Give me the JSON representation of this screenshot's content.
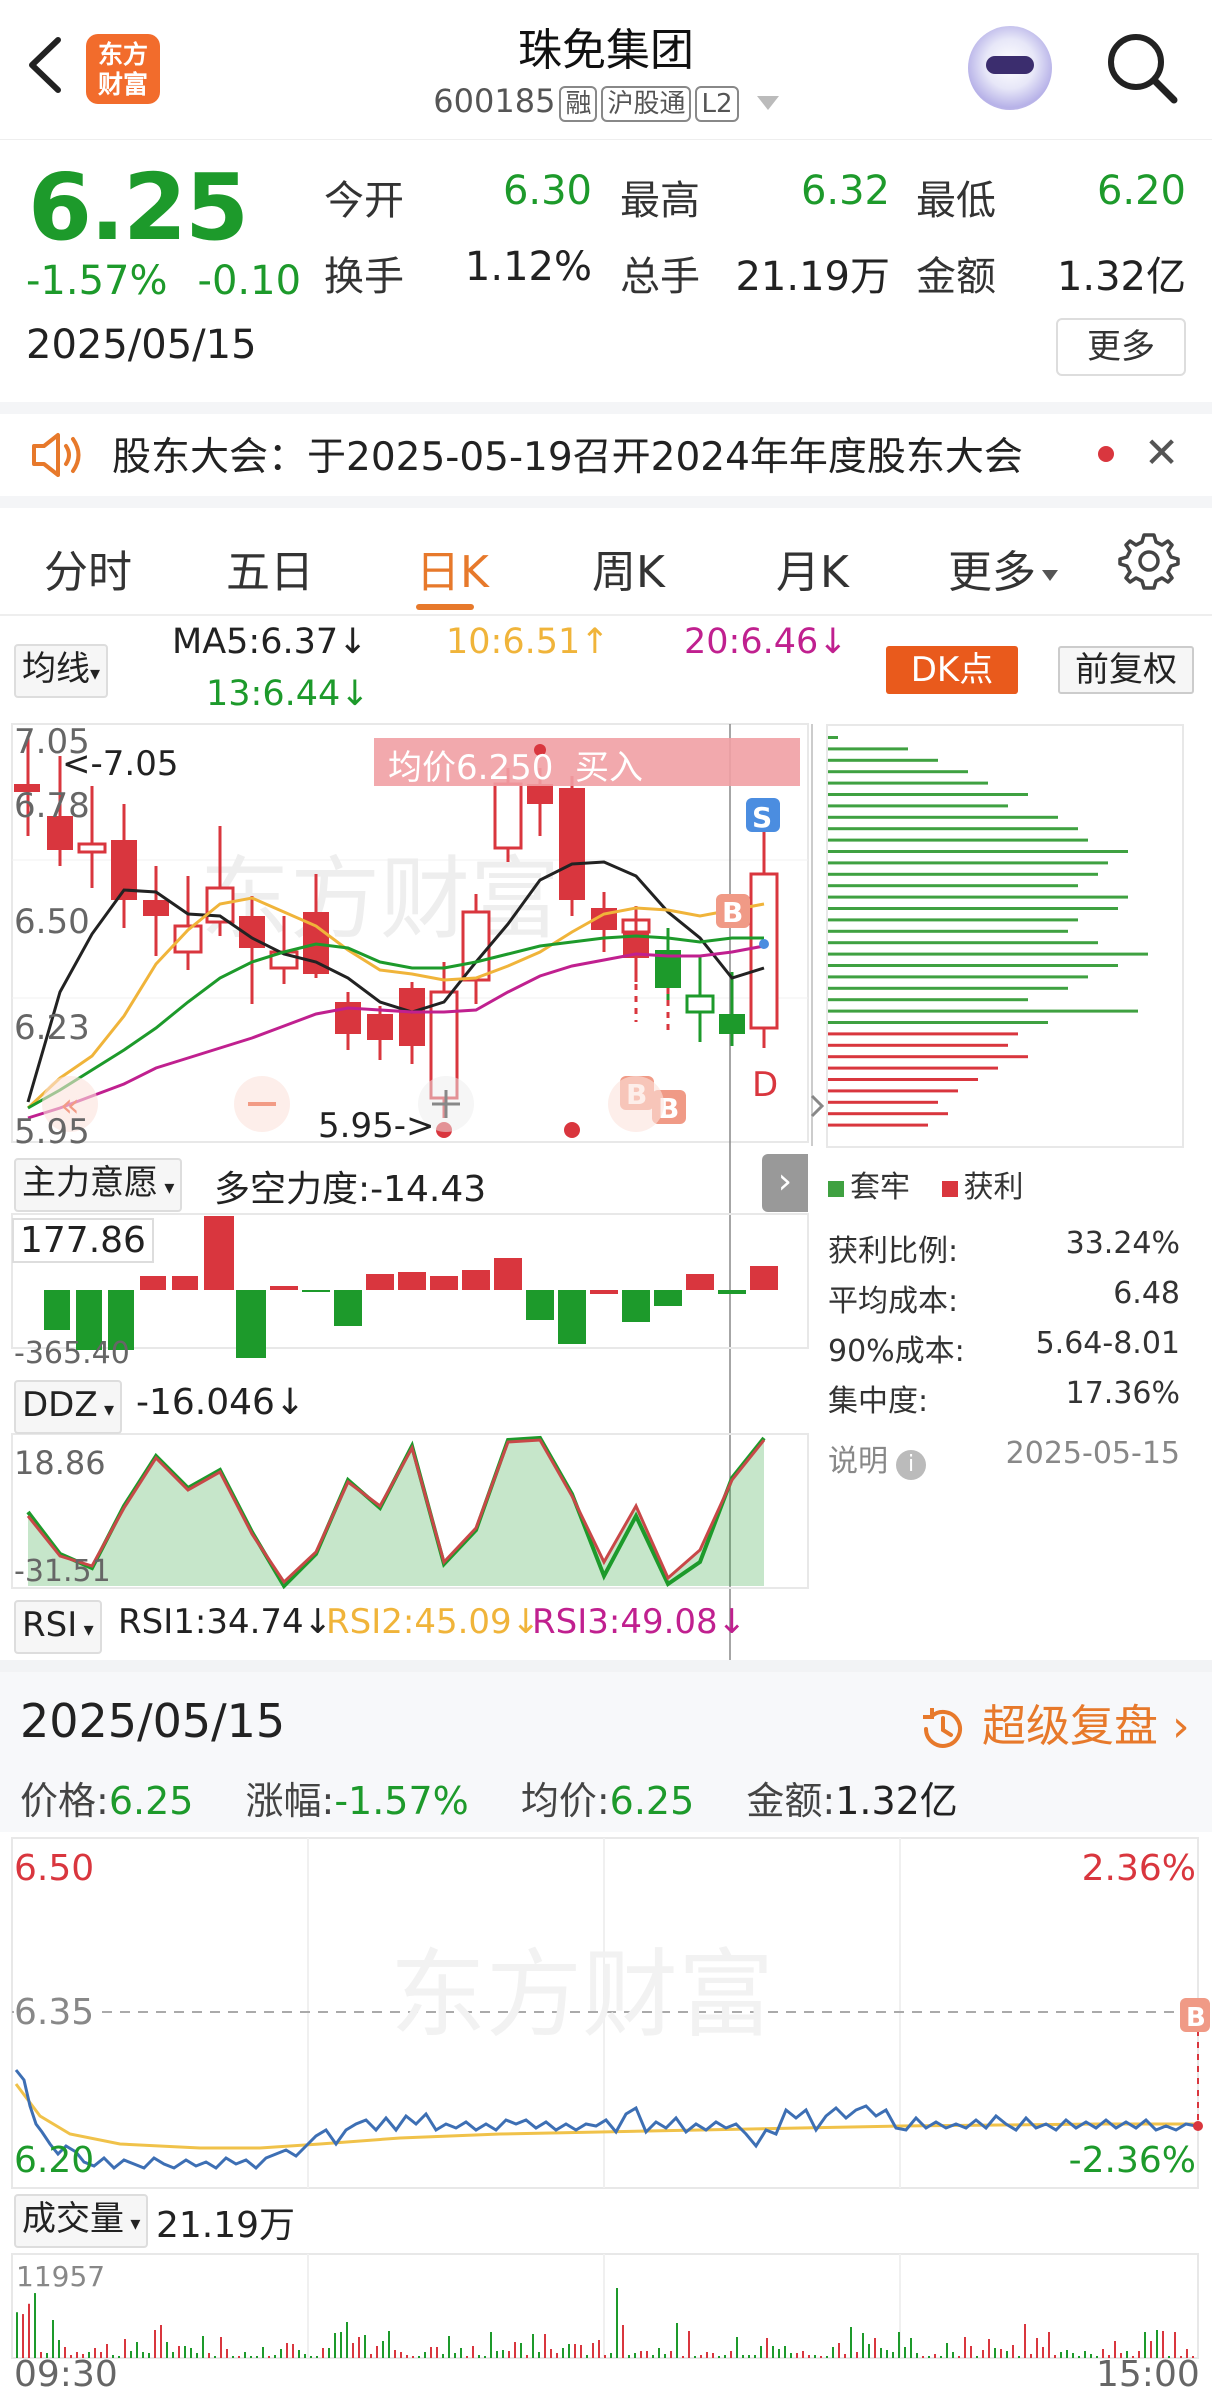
{
  "header": {
    "back_icon": "back-arrow-icon",
    "logo_text": "东方\n财富",
    "title": "珠免集团",
    "code": "600185",
    "tags": [
      "融",
      "沪股通",
      "L2"
    ]
  },
  "quote": {
    "price": "6.25",
    "change_pct": "-1.57%",
    "change": "-0.10",
    "date": "2025/05/15",
    "fields": [
      {
        "label": "今开",
        "value": "6.30",
        "color": "green"
      },
      {
        "label": "最高",
        "value": "6.32",
        "color": "green"
      },
      {
        "label": "最低",
        "value": "6.20",
        "color": "green"
      },
      {
        "label": "换手",
        "value": "1.12%",
        "color": "black"
      },
      {
        "label": "总手",
        "value": "21.19万",
        "color": "black"
      },
      {
        "label": "金额",
        "value": "1.32亿",
        "color": "black"
      }
    ],
    "more_label": "更多"
  },
  "notice": {
    "text": "股东大会：于2025-05-19召开2024年年度股东大会"
  },
  "tabs": [
    "分时",
    "五日",
    "日K",
    "周K",
    "月K",
    "更多"
  ],
  "active_tab": "日K",
  "ma_bar": {
    "selector": "均线",
    "ma5": "MA5:6.37↓",
    "ma10": "10:6.51↑",
    "ma20": "20:6.46↓",
    "ma13": "13:6.44↓",
    "dk_label": "DK点",
    "fuquan_label": "前复权",
    "colors": {
      "ma5": "#222222",
      "ma10": "#f0b43a",
      "ma20": "#c0208f",
      "ma13": "#1d9a2b"
    }
  },
  "kline": {
    "y_labels": [
      "7.05",
      "6.78",
      "6.50",
      "6.23",
      "5.95"
    ],
    "high_marker": "<-7.05",
    "low_marker": "5.95->",
    "avg_banner": "均价6.250  买入",
    "sell_marker": "S",
    "buy_marker": "B",
    "d_marker": "D"
  },
  "chip": {
    "legend_trap": "套牢",
    "legend_profit": "获利",
    "rows": [
      {
        "label": "获利比例:",
        "value": "33.24%"
      },
      {
        "label": "平均成本:",
        "value": "6.48"
      },
      {
        "label": "90%成本:",
        "value": "5.64-8.01"
      },
      {
        "label": "集中度:",
        "value": "17.36%"
      }
    ],
    "note_label": "说明",
    "note_date": "2025-05-15"
  },
  "indicator1": {
    "selector": "主力意愿",
    "text": "多空力度:-14.43",
    "top": "177.86",
    "bottom": "-365.40"
  },
  "indicator2": {
    "selector": "DDZ",
    "text": "-16.046↓",
    "top": "18.86",
    "bottom": "-31.51"
  },
  "indicator3": {
    "selector": "RSI",
    "rsi1": "RSI1:34.74↓",
    "rsi2": "RSI2:45.09↓",
    "rsi3": "RSI3:49.08↓"
  },
  "summary": {
    "date": "2025/05/15",
    "super_label": "超级复盘",
    "price_label": "价格:",
    "price": "6.25",
    "change_label": "涨幅:",
    "change": "-1.57%",
    "avg_label": "均价:",
    "avg": "6.25",
    "amount_label": "金额:",
    "amount": "1.32亿"
  },
  "intraday": {
    "top_left": "6.50",
    "mid_left": "6.35",
    "bottom_left": "6.20",
    "top_right": "2.36%",
    "bottom_right": "-2.36%",
    "watermark": "东方财富"
  },
  "volume": {
    "selector": "成交量",
    "value": "21.19万",
    "max_label": "11957",
    "start_time": "09:30",
    "end_time": "15:00"
  }
}
